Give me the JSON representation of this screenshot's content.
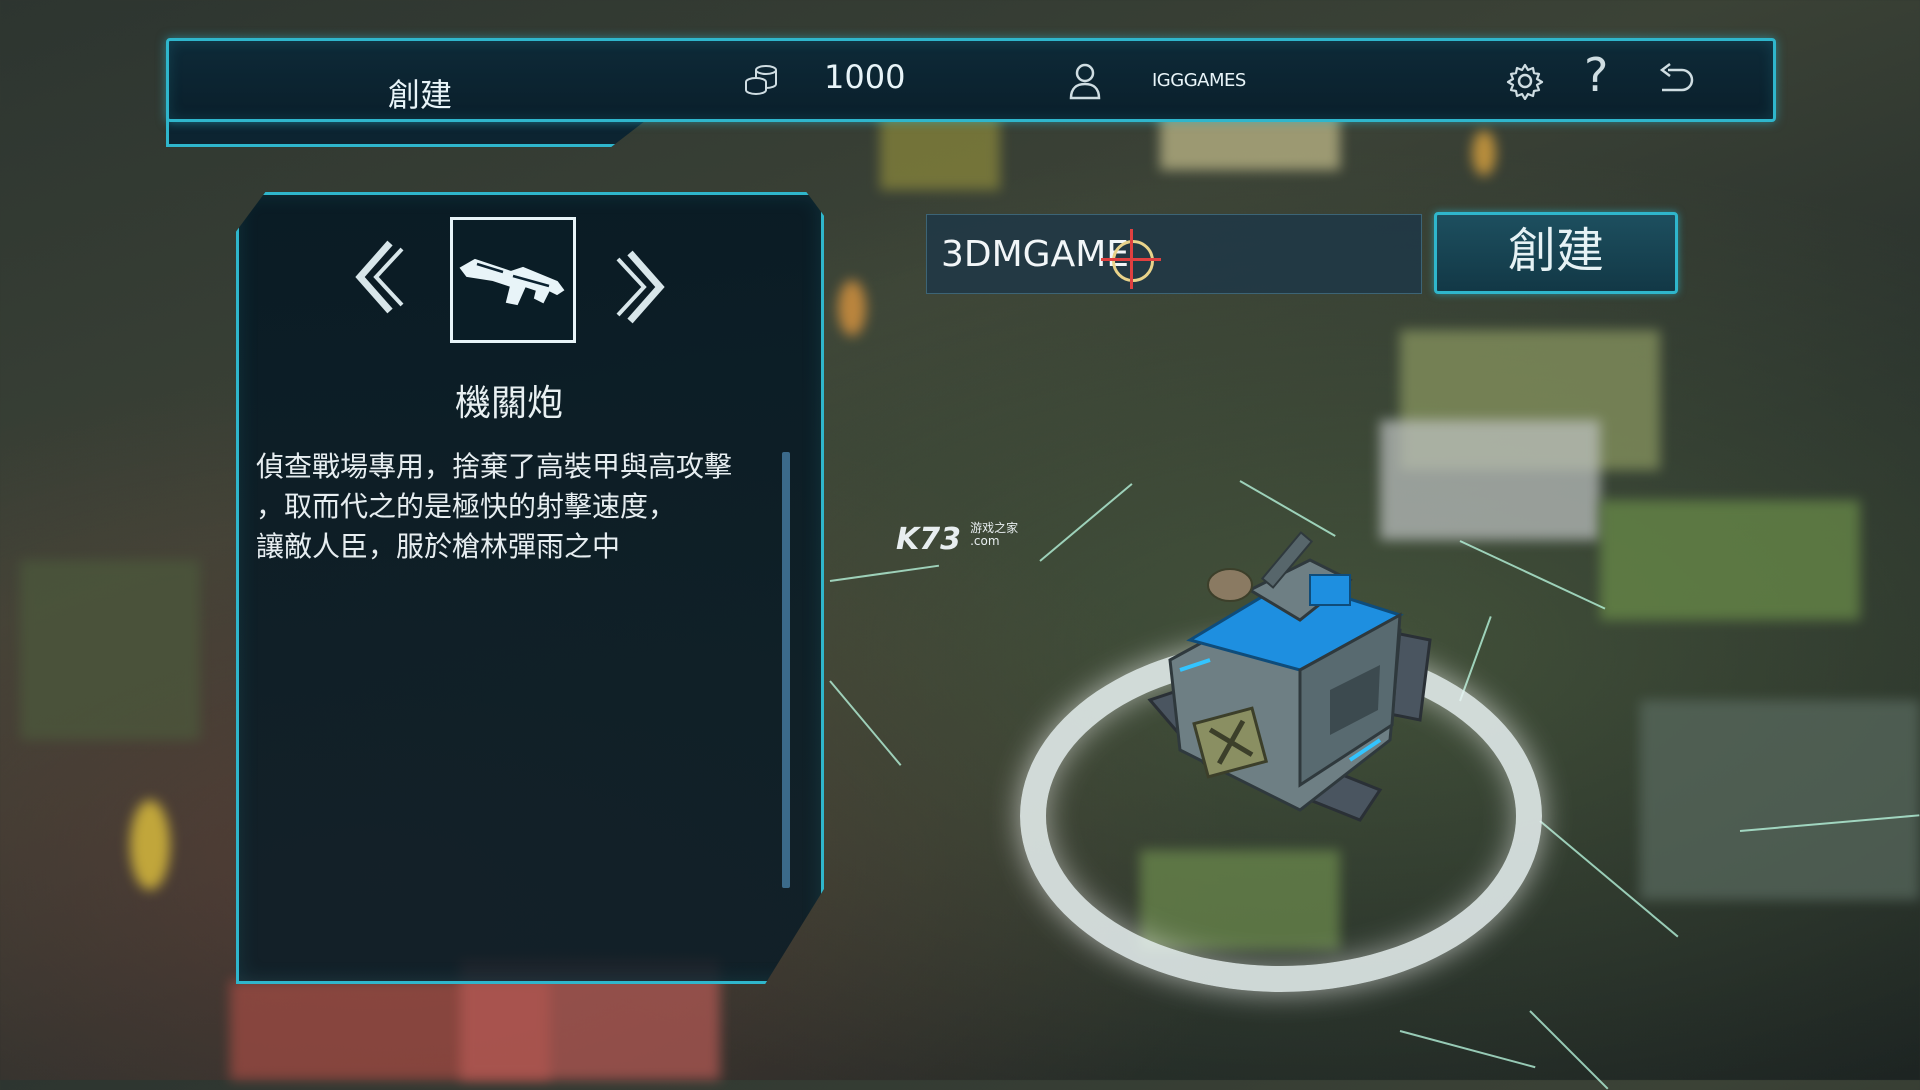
{
  "topbar": {
    "title": "創建",
    "coins": "1000",
    "username": "IGGGAMES",
    "icons": [
      "coins-icon",
      "user-icon",
      "gear-icon",
      "help-icon",
      "back-icon"
    ]
  },
  "weapon_panel": {
    "prev_icon": "chevron-left-icon",
    "next_icon": "chevron-right-icon",
    "weapon_icon": "machine-gun-icon",
    "weapon_name": "機關炮",
    "description_lines": [
      "偵查戰場專用，捨棄了高裝甲與高攻擊",
      "，取而代之的是極快的射擊速度，",
      "讓敵人臣，服於槍林彈雨之中"
    ]
  },
  "name_input": {
    "value": "3DMGAME"
  },
  "create_button": {
    "label": "創建"
  },
  "watermark": {
    "brand": "K73",
    "sub1": "游戏之家",
    "sub2": ".com"
  },
  "colors": {
    "accent": "#2fb6cc",
    "panel_bg": "#0a1f2b",
    "tank_blue": "#1e8fe0"
  }
}
